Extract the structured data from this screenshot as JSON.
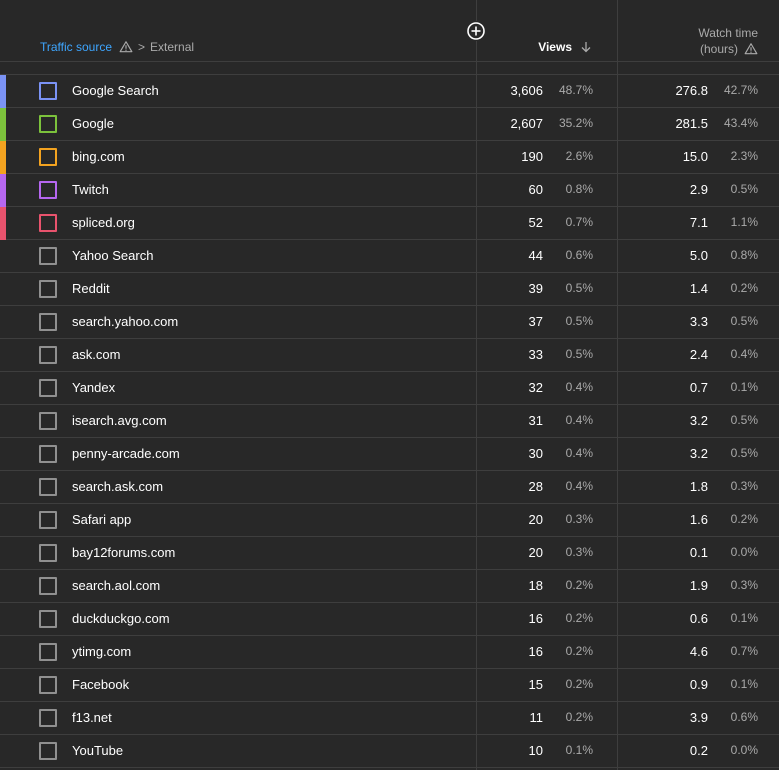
{
  "header": {
    "traffic_source_label": "Traffic source",
    "breadcrumb_separator": ">",
    "breadcrumb_current": "External",
    "views_label": "Views",
    "watch_time_line1": "Watch time",
    "watch_time_line2": "(hours)"
  },
  "colors": {
    "accent_link": "#3ea6ff",
    "series": [
      "#7b93f5",
      "#7cc23c",
      "#f3a320",
      "#b667f0",
      "#e8536d"
    ]
  },
  "rows": [
    {
      "source": "Google Search",
      "views": "3,606",
      "views_pct": "48.7%",
      "watch": "276.8",
      "watch_pct": "42.7%",
      "color": "#7b93f5"
    },
    {
      "source": "Google",
      "views": "2,607",
      "views_pct": "35.2%",
      "watch": "281.5",
      "watch_pct": "43.4%",
      "color": "#7cc23c"
    },
    {
      "source": "bing.com",
      "views": "190",
      "views_pct": "2.6%",
      "watch": "15.0",
      "watch_pct": "2.3%",
      "color": "#f3a320"
    },
    {
      "source": "Twitch",
      "views": "60",
      "views_pct": "0.8%",
      "watch": "2.9",
      "watch_pct": "0.5%",
      "color": "#b667f0"
    },
    {
      "source": "spliced.org",
      "views": "52",
      "views_pct": "0.7%",
      "watch": "7.1",
      "watch_pct": "1.1%",
      "color": "#e8536d"
    },
    {
      "source": "Yahoo Search",
      "views": "44",
      "views_pct": "0.6%",
      "watch": "5.0",
      "watch_pct": "0.8%",
      "color": ""
    },
    {
      "source": "Reddit",
      "views": "39",
      "views_pct": "0.5%",
      "watch": "1.4",
      "watch_pct": "0.2%",
      "color": ""
    },
    {
      "source": "search.yahoo.com",
      "views": "37",
      "views_pct": "0.5%",
      "watch": "3.3",
      "watch_pct": "0.5%",
      "color": ""
    },
    {
      "source": "ask.com",
      "views": "33",
      "views_pct": "0.5%",
      "watch": "2.4",
      "watch_pct": "0.4%",
      "color": ""
    },
    {
      "source": "Yandex",
      "views": "32",
      "views_pct": "0.4%",
      "watch": "0.7",
      "watch_pct": "0.1%",
      "color": ""
    },
    {
      "source": "isearch.avg.com",
      "views": "31",
      "views_pct": "0.4%",
      "watch": "3.2",
      "watch_pct": "0.5%",
      "color": ""
    },
    {
      "source": "penny-arcade.com",
      "views": "30",
      "views_pct": "0.4%",
      "watch": "3.2",
      "watch_pct": "0.5%",
      "color": ""
    },
    {
      "source": "search.ask.com",
      "views": "28",
      "views_pct": "0.4%",
      "watch": "1.8",
      "watch_pct": "0.3%",
      "color": ""
    },
    {
      "source": "Safari app",
      "views": "20",
      "views_pct": "0.3%",
      "watch": "1.6",
      "watch_pct": "0.2%",
      "color": ""
    },
    {
      "source": "bay12forums.com",
      "views": "20",
      "views_pct": "0.3%",
      "watch": "0.1",
      "watch_pct": "0.0%",
      "color": ""
    },
    {
      "source": "search.aol.com",
      "views": "18",
      "views_pct": "0.2%",
      "watch": "1.9",
      "watch_pct": "0.3%",
      "color": ""
    },
    {
      "source": "duckduckgo.com",
      "views": "16",
      "views_pct": "0.2%",
      "watch": "0.6",
      "watch_pct": "0.1%",
      "color": ""
    },
    {
      "source": "ytimg.com",
      "views": "16",
      "views_pct": "0.2%",
      "watch": "4.6",
      "watch_pct": "0.7%",
      "color": ""
    },
    {
      "source": "Facebook",
      "views": "15",
      "views_pct": "0.2%",
      "watch": "0.9",
      "watch_pct": "0.1%",
      "color": ""
    },
    {
      "source": "f13.net",
      "views": "11",
      "views_pct": "0.2%",
      "watch": "3.9",
      "watch_pct": "0.6%",
      "color": ""
    },
    {
      "source": "YouTube",
      "views": "10",
      "views_pct": "0.1%",
      "watch": "0.2",
      "watch_pct": "0.0%",
      "color": ""
    }
  ]
}
